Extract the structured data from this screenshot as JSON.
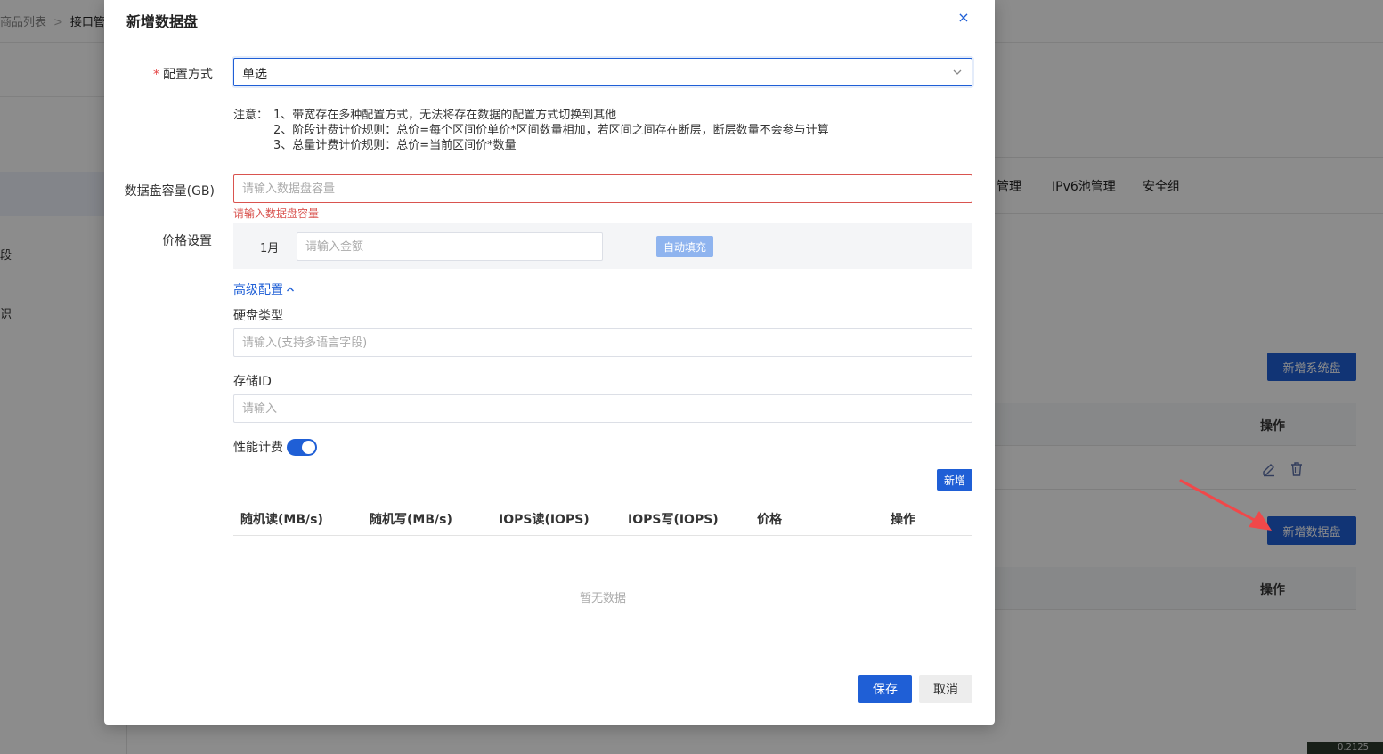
{
  "background": {
    "breadcrumb": [
      "商品列表",
      "接口管理"
    ],
    "sidebar_fragments": [
      "段",
      "识"
    ],
    "tabs": [
      "管理",
      "IPv6池管理",
      "安全组"
    ],
    "add_system_disk_label": "新增系统盘",
    "add_data_disk_label": "新增数据盘",
    "operation_header": "操作",
    "footer_chip": "0.2125"
  },
  "modal": {
    "title": "新增数据盘",
    "close_glyph": "×",
    "config_mode": {
      "label": "配置方式",
      "required_mark": "*",
      "value": "单选"
    },
    "notes": {
      "prefix": "注意：",
      "lines": [
        "1、带宽存在多种配置方式，无法将存在数据的配置方式切换到其他",
        "2、阶段计费计价规则：总价=每个区间价单价*区间数量相加，若区间之间存在断层，断层数量不会参与计算",
        "3、总量计费计价规则：总价=当前区间价*数量"
      ]
    },
    "capacity": {
      "label": "数据盘容量(GB)",
      "placeholder": "请输入数据盘容量",
      "error": "请输入数据盘容量"
    },
    "price": {
      "label": "价格设置",
      "month": "1月",
      "placeholder": "请输入金额",
      "autofill_label": "自动填充"
    },
    "advanced_label": "高级配置",
    "disk_type": {
      "label": "硬盘类型",
      "placeholder": "请输入(支持多语言字段)"
    },
    "storage_id": {
      "label": "存储ID",
      "placeholder": "请输入"
    },
    "perf_billing": {
      "label": "性能计费",
      "enabled": true
    },
    "add_label": "新增",
    "table": {
      "headers": [
        "随机读(MB/s)",
        "随机写(MB/s)",
        "IOPS读(IOPS)",
        "IOPS写(IOPS)",
        "价格",
        "操作"
      ],
      "empty_text": "暂无数据"
    },
    "save_label": "保存",
    "cancel_label": "取消"
  },
  "colors": {
    "primary": "#1f5fd6",
    "error": "#d9534f",
    "arrow": "#f0484a"
  }
}
